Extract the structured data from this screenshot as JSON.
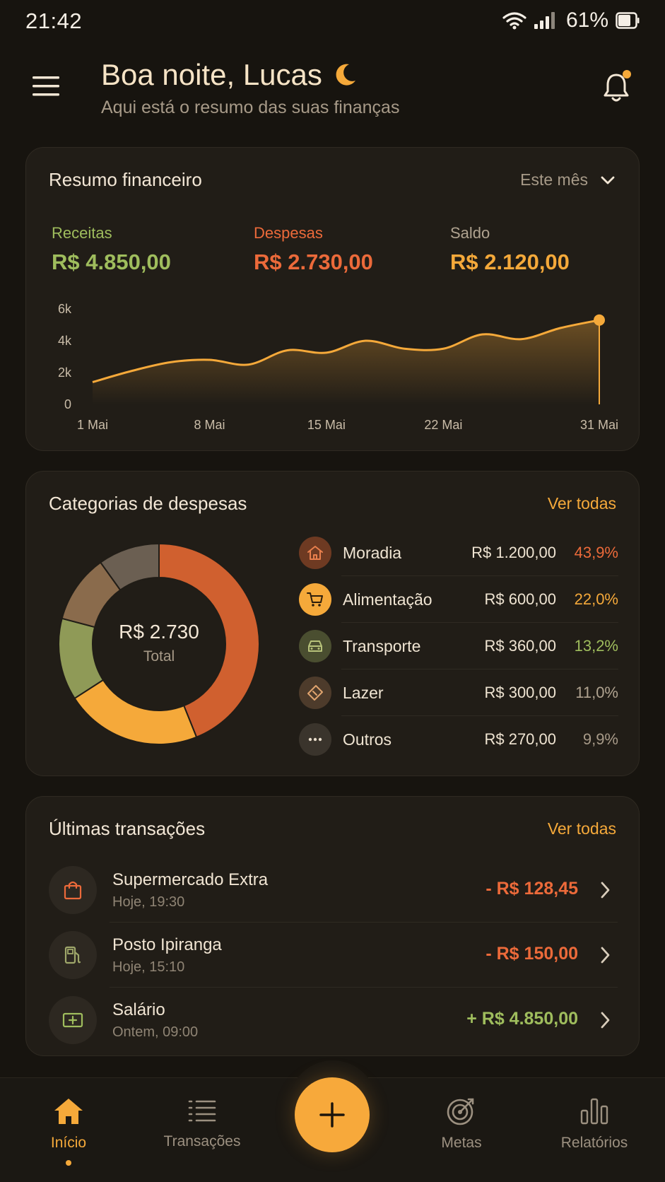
{
  "status_bar": {
    "time": "21:42",
    "battery": "61%"
  },
  "header": {
    "greeting": "Boa noite, Lucas",
    "subtitle": "Aqui está o resumo das suas finanças"
  },
  "summary": {
    "title": "Resumo financeiro",
    "period": "Este mês",
    "income_label": "Receitas",
    "income_value": "R$ 4.850,00",
    "expenses_label": "Despesas",
    "expenses_value": "R$ 2.730,00",
    "balance_label": "Saldo",
    "balance_value": "R$ 2.120,00"
  },
  "chart_data": {
    "type": "area",
    "x": [
      "1 Mai",
      "3 Mai",
      "5 Mai",
      "8 Mai",
      "10 Mai",
      "12 Mai",
      "15 Mai",
      "17 Mai",
      "19 Mai",
      "22 Mai",
      "24 Mai",
      "26 Mai",
      "28 Mai",
      "31 Mai"
    ],
    "xticks": [
      "1 Mai",
      "8 Mai",
      "15 Mai",
      "22 Mai",
      "31 Mai"
    ],
    "y": [
      1400,
      2100,
      2650,
      2800,
      2500,
      3400,
      3250,
      4000,
      3500,
      3500,
      4400,
      4100,
      4800,
      5300
    ],
    "yticks": [
      "0",
      "2k",
      "4k",
      "6k"
    ],
    "ylim": [
      0,
      6000
    ],
    "color": "#f5a93a",
    "title": "",
    "xlabel": "",
    "ylabel": ""
  },
  "categories": {
    "title": "Categorias de despesas",
    "link": "Ver todas",
    "total_value": "R$ 2.730",
    "total_label": "Total",
    "items": [
      {
        "name": "Moradia",
        "amount": "R$ 1.200,00",
        "pct": "43,9%",
        "share": 43.9,
        "color": "#d0602f",
        "icon": "home-icon"
      },
      {
        "name": "Alimentação",
        "amount": "R$ 600,00",
        "pct": "22,0%",
        "share": 22.0,
        "color": "#f5a93a",
        "icon": "cart-icon"
      },
      {
        "name": "Transporte",
        "amount": "R$ 360,00",
        "pct": "13,2%",
        "share": 13.2,
        "color": "#8f9a57",
        "icon": "car-icon"
      },
      {
        "name": "Lazer",
        "amount": "R$ 300,00",
        "pct": "11,0%",
        "share": 11.0,
        "color": "#8a6b4c",
        "icon": "ticket-icon"
      },
      {
        "name": "Outros",
        "amount": "R$ 270,00",
        "pct": "9,9%",
        "share": 9.9,
        "color": "#6b5f52",
        "icon": "more-icon"
      }
    ]
  },
  "transactions": {
    "title": "Últimas transações",
    "link": "Ver todas",
    "items": [
      {
        "title": "Supermercado Extra",
        "date": "Hoje, 19:30",
        "amount": "- R$ 128,45",
        "color": "#ec6a3a",
        "icon": "shopping-bag-icon"
      },
      {
        "title": "Posto Ipiranga",
        "date": "Hoje, 15:10",
        "amount": "- R$ 150,00",
        "color": "#ec6a3a",
        "icon": "fuel-pump-icon"
      },
      {
        "title": "Salário",
        "date": "Ontem, 09:00",
        "amount": "+ R$ 4.850,00",
        "color": "#9fbd5d",
        "icon": "income-icon"
      }
    ]
  },
  "nav": {
    "home": "Início",
    "transactions": "Transações",
    "goals": "Metas",
    "reports": "Relatórios"
  }
}
